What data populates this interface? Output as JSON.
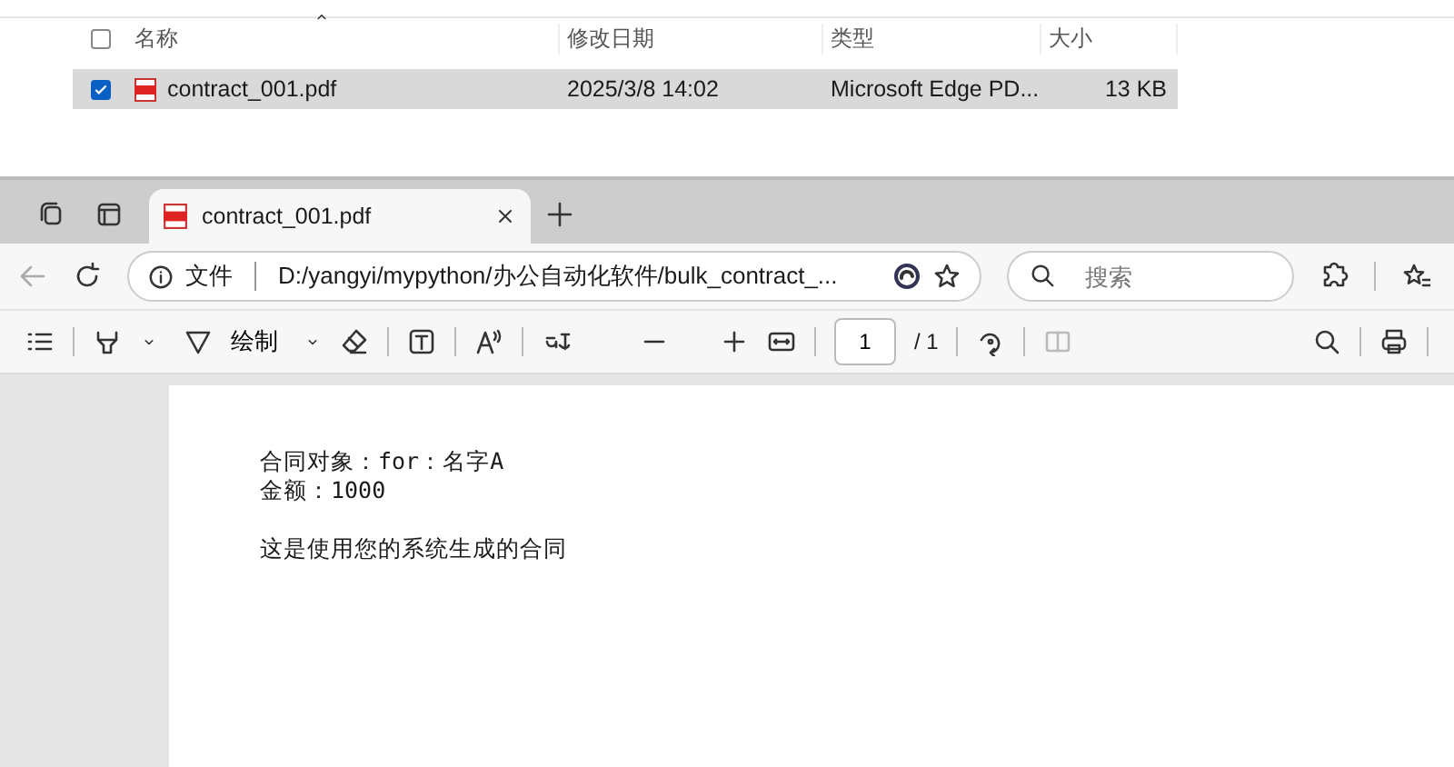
{
  "explorer": {
    "header_checkbox": {
      "checked": false
    },
    "columns": [
      {
        "label": "名称"
      },
      {
        "label": "修改日期"
      },
      {
        "label": "类型"
      },
      {
        "label": "大小"
      }
    ],
    "rows": [
      {
        "selected": true,
        "checked": true,
        "name": "contract_001.pdf",
        "modified": "2025/3/8 14:02",
        "type": "Microsoft Edge PD...",
        "size": "13 KB"
      }
    ]
  },
  "browser": {
    "tab": {
      "title": "contract_001.pdf"
    },
    "address": {
      "scheme_label": "文件",
      "url": "D:/yangyi/mypython/办公自动化软件/bulk_contract_..."
    },
    "search": {
      "placeholder": "搜索"
    },
    "pdf_toolbar": {
      "draw_label": "绘制",
      "page_value": "1",
      "page_total": "/ 1"
    },
    "document": {
      "paragraphs": [
        [
          "合同对象：for：名字A",
          "金额：1000"
        ],
        [
          "这是使用您的系统生成的合同"
        ]
      ]
    }
  }
}
